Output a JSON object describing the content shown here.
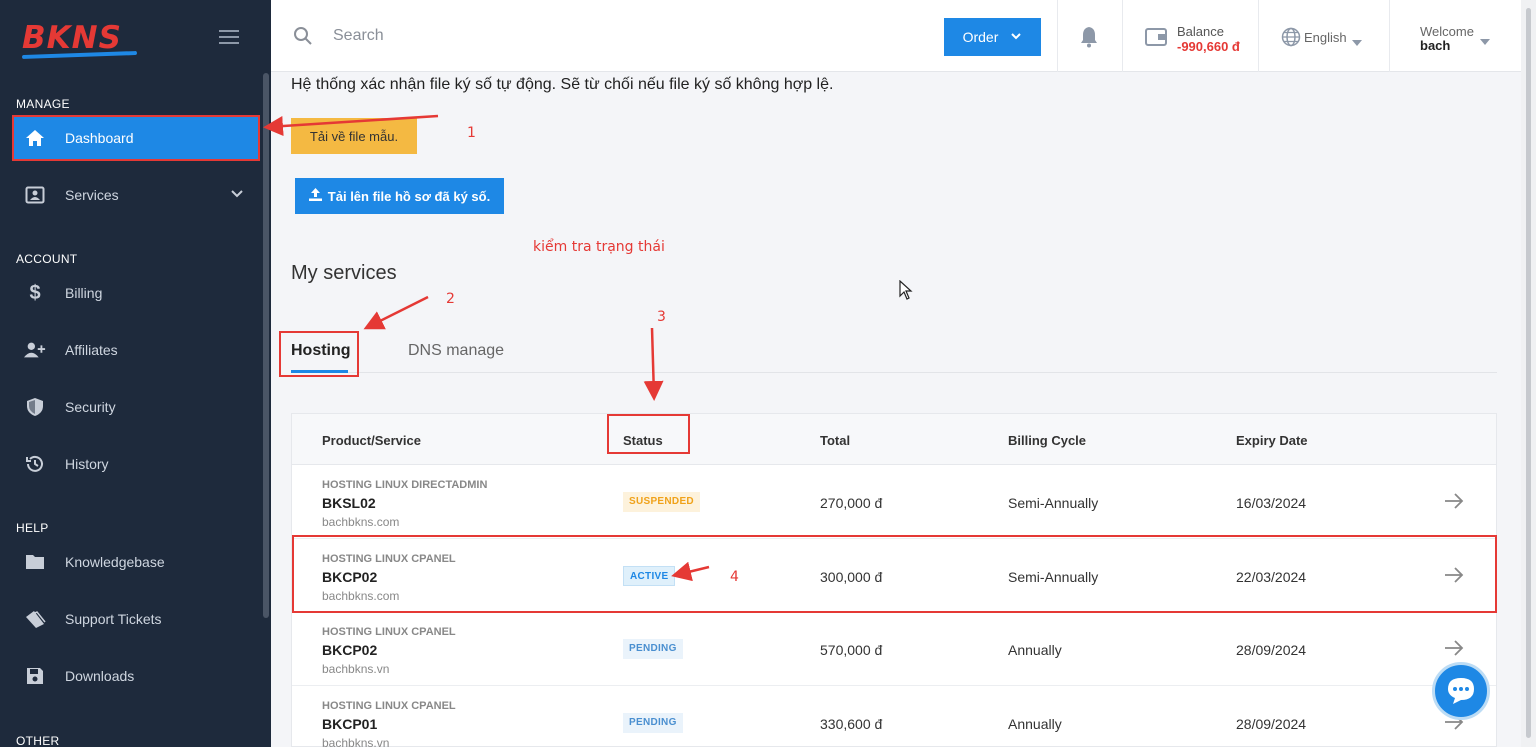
{
  "brand": {
    "logo_text": "BKNS"
  },
  "sidebar": {
    "sections": {
      "manage": "MANAGE",
      "account": "ACCOUNT",
      "help": "HELP",
      "other": "OTHER"
    },
    "items": [
      {
        "label": "Dashboard",
        "icon": "home-icon"
      },
      {
        "label": "Services",
        "icon": "id-card-icon"
      },
      {
        "label": "Billing",
        "icon": "dollar-icon"
      },
      {
        "label": "Affiliates",
        "icon": "user-plus-icon"
      },
      {
        "label": "Security",
        "icon": "shield-icon"
      },
      {
        "label": "History",
        "icon": "history-icon"
      },
      {
        "label": "Knowledgebase",
        "icon": "folder-icon"
      },
      {
        "label": "Support Tickets",
        "icon": "tickets-icon"
      },
      {
        "label": "Downloads",
        "icon": "floppy-icon"
      }
    ]
  },
  "topbar": {
    "search_placeholder": "Search",
    "order_label": "Order",
    "balance_label": "Balance",
    "balance_value": "-990,660 đ",
    "language": "English",
    "welcome": "Welcome",
    "username": "bach"
  },
  "main": {
    "intro_text": "Hệ thống xác nhận file ký số tự động. Sẽ từ chối nếu file ký số không hợp lệ.",
    "download_label": "Tải về file mẫu.",
    "upload_label": "Tải lên file hồ sơ đã ký số.",
    "section_title": "My services",
    "tabs": [
      {
        "label": "Hosting"
      },
      {
        "label": "DNS manage"
      }
    ]
  },
  "annotations": {
    "n1": "1",
    "n2": "2",
    "n3": "3",
    "n4": "4",
    "note": "kiểm tra trạng thái"
  },
  "table": {
    "headers": {
      "product": "Product/Service",
      "status": "Status",
      "total": "Total",
      "cycle": "Billing Cycle",
      "expiry": "Expiry Date"
    },
    "rows": [
      {
        "type": "HOSTING LINUX DIRECTADMIN",
        "name": "BKSL02",
        "domain": "bachbkns.com",
        "status": "SUSPENDED",
        "total": "270,000 đ",
        "cycle": "Semi-Annually",
        "expiry": "16/03/2024"
      },
      {
        "type": "HOSTING LINUX CPANEL",
        "name": "BKCP02",
        "domain": "bachbkns.com",
        "status": "ACTIVE",
        "total": "300,000 đ",
        "cycle": "Semi-Annually",
        "expiry": "22/03/2024"
      },
      {
        "type": "HOSTING LINUX CPANEL",
        "name": "BKCP02",
        "domain": "bachbkns.vn",
        "status": "PENDING",
        "total": "570,000 đ",
        "cycle": "Annually",
        "expiry": "28/09/2024"
      },
      {
        "type": "HOSTING LINUX CPANEL",
        "name": "BKCP01",
        "domain": "bachbkns.vn",
        "status": "PENDING",
        "total": "330,600 đ",
        "cycle": "Annually",
        "expiry": "28/09/2024"
      }
    ]
  },
  "colors": {
    "sidebar_bg": "#1e2a3c",
    "accent": "#1e88e5",
    "annotation": "#e53935",
    "download_btn": "#f4b942"
  }
}
